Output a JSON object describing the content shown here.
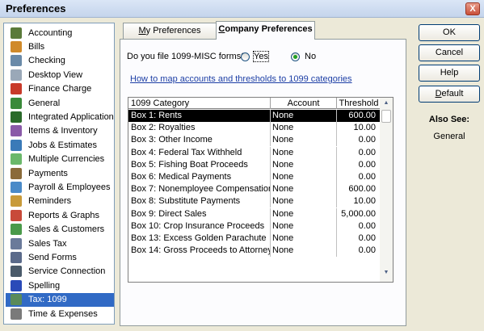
{
  "window": {
    "title": "Preferences",
    "close_glyph": "X"
  },
  "categories": [
    {
      "label": "Accounting",
      "icon": "accounting-icon",
      "color": "#5a7a3a"
    },
    {
      "label": "Bills",
      "icon": "bills-icon",
      "color": "#d08a2a"
    },
    {
      "label": "Checking",
      "icon": "checking-icon",
      "color": "#6a8aa8"
    },
    {
      "label": "Desktop View",
      "icon": "desktop-view-icon",
      "color": "#9aa8b8"
    },
    {
      "label": "Finance Charge",
      "icon": "finance-charge-icon",
      "color": "#c83a2a"
    },
    {
      "label": "General",
      "icon": "general-icon",
      "color": "#3a8a3a"
    },
    {
      "label": "Integrated Applications",
      "icon": "integrated-applications-icon",
      "color": "#2a6a2a"
    },
    {
      "label": "Items & Inventory",
      "icon": "items-inventory-icon",
      "color": "#8a5aa8"
    },
    {
      "label": "Jobs & Estimates",
      "icon": "jobs-estimates-icon",
      "color": "#3a7ab8"
    },
    {
      "label": "Multiple Currencies",
      "icon": "multiple-currencies-icon",
      "color": "#6ab86a"
    },
    {
      "label": "Payments",
      "icon": "payments-icon",
      "color": "#8a6a3a"
    },
    {
      "label": "Payroll & Employees",
      "icon": "payroll-employees-icon",
      "color": "#4a8ac8"
    },
    {
      "label": "Reminders",
      "icon": "reminders-icon",
      "color": "#c89a3a"
    },
    {
      "label": "Reports & Graphs",
      "icon": "reports-graphs-icon",
      "color": "#c84a3a"
    },
    {
      "label": "Sales & Customers",
      "icon": "sales-customers-icon",
      "color": "#4a9a4a"
    },
    {
      "label": "Sales Tax",
      "icon": "sales-tax-icon",
      "color": "#6a7a9a"
    },
    {
      "label": "Send Forms",
      "icon": "send-forms-icon",
      "color": "#5a6a8a"
    },
    {
      "label": "Service Connection",
      "icon": "service-connection-icon",
      "color": "#4a5a6a"
    },
    {
      "label": "Spelling",
      "icon": "spelling-icon",
      "color": "#2a4ab8"
    },
    {
      "label": "Tax: 1099",
      "icon": "tax-1099-icon",
      "color": "#5a8a5a",
      "selected": true
    },
    {
      "label": "Time & Expenses",
      "icon": "time-expenses-icon",
      "color": "#7a7a7a"
    }
  ],
  "tabs": [
    {
      "label": "My Preferences",
      "underline": "M",
      "rest": "y Preferences",
      "active": false
    },
    {
      "label": "Company Preferences",
      "underline": "C",
      "rest": "ompany Preferences",
      "active": true
    }
  ],
  "form": {
    "question": "Do you file 1099-MISC forms?",
    "yes_label": "Yes",
    "no_label": "No",
    "selected": "No",
    "link": "How to map accounts and thresholds to 1099 categories"
  },
  "table": {
    "columns": [
      "1099 Category",
      "Account",
      "Threshold"
    ],
    "rows": [
      {
        "category": "Box 1: Rents",
        "account": "None",
        "threshold": "600.00"
      },
      {
        "category": "Box 2: Royalties",
        "account": "None",
        "threshold": "10.00"
      },
      {
        "category": "Box 3: Other Income",
        "account": "None",
        "threshold": "0.00"
      },
      {
        "category": "Box 4: Federal Tax Withheld",
        "account": "None",
        "threshold": "0.00"
      },
      {
        "category": "Box 5: Fishing Boat Proceeds",
        "account": "None",
        "threshold": "0.00"
      },
      {
        "category": "Box 6: Medical Payments",
        "account": "None",
        "threshold": "0.00"
      },
      {
        "category": "Box 7: Nonemployee Compensation",
        "account": "None",
        "threshold": "600.00"
      },
      {
        "category": "Box 8: Substitute Payments",
        "account": "None",
        "threshold": "10.00"
      },
      {
        "category": "Box 9: Direct Sales",
        "account": "None",
        "threshold": "5,000.00"
      },
      {
        "category": "Box 10: Crop Insurance Proceeds",
        "account": "None",
        "threshold": "0.00"
      },
      {
        "category": "Box 13: Excess Golden Parachute",
        "account": "None",
        "threshold": "0.00"
      },
      {
        "category": "Box 14: Gross Proceeds to Attorney",
        "account": "None",
        "threshold": "0.00"
      }
    ],
    "selected_row": 0
  },
  "buttons": {
    "ok": "OK",
    "cancel": "Cancel",
    "help": "Help",
    "default": "Default",
    "default_ul": "D",
    "default_rest": "efault"
  },
  "also_see": {
    "title": "Also See:",
    "items": [
      "General"
    ]
  },
  "colors": {
    "selection": "#316ac5",
    "link": "#1c3ea5",
    "dialog_bg": "#ece9d8"
  }
}
